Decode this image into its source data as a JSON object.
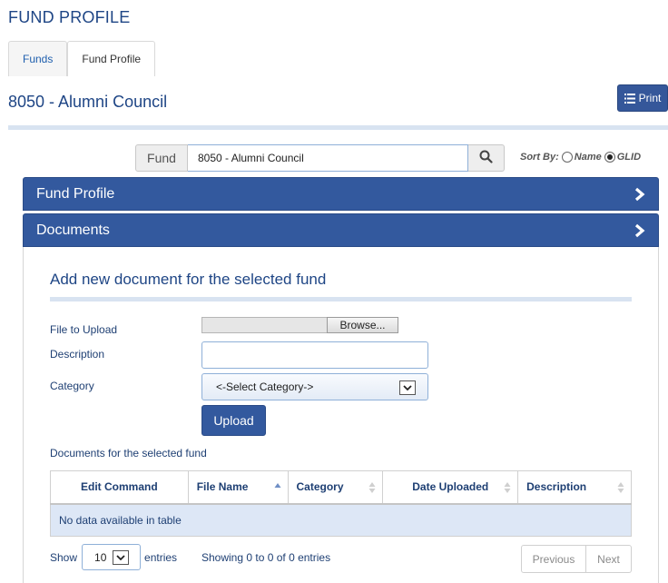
{
  "page": {
    "title": "FUND PROFILE"
  },
  "tabs": [
    {
      "label": "Funds"
    },
    {
      "label": "Fund Profile"
    }
  ],
  "fund_heading": "8050 - Alumni Council",
  "print_button": {
    "label": "Print",
    "icon": "list-icon"
  },
  "fund_search": {
    "addon_label": "Fund",
    "value": "8050 - Alumni Council",
    "icon": "search-icon"
  },
  "sort_by": {
    "label": "Sort By:",
    "options": [
      "Name",
      "GLID"
    ],
    "selected": "GLID"
  },
  "panels": {
    "fund_profile": "Fund Profile",
    "documents": "Documents"
  },
  "documents_form": {
    "title": "Add new document for the selected fund",
    "file_label": "File to Upload",
    "browse_label": "Browse...",
    "description_label": "Description",
    "description_value": "",
    "category_label": "Category",
    "category_selected": "<-Select Category->",
    "upload_label": "Upload"
  },
  "documents_table": {
    "caption": "Documents for the selected fund",
    "columns": [
      "Edit Command",
      "File Name",
      "Category",
      "Date Uploaded",
      "Description"
    ],
    "empty_message": "No data available in table",
    "show_label": "Show",
    "page_length": "10",
    "entries_label": "entries",
    "info": "Showing 0 to 0 of 0 entries",
    "previous": "Previous",
    "next": "Next"
  },
  "colors": {
    "accent": "#33599e",
    "title": "#1e4585",
    "row_bg": "#dde7f6"
  }
}
